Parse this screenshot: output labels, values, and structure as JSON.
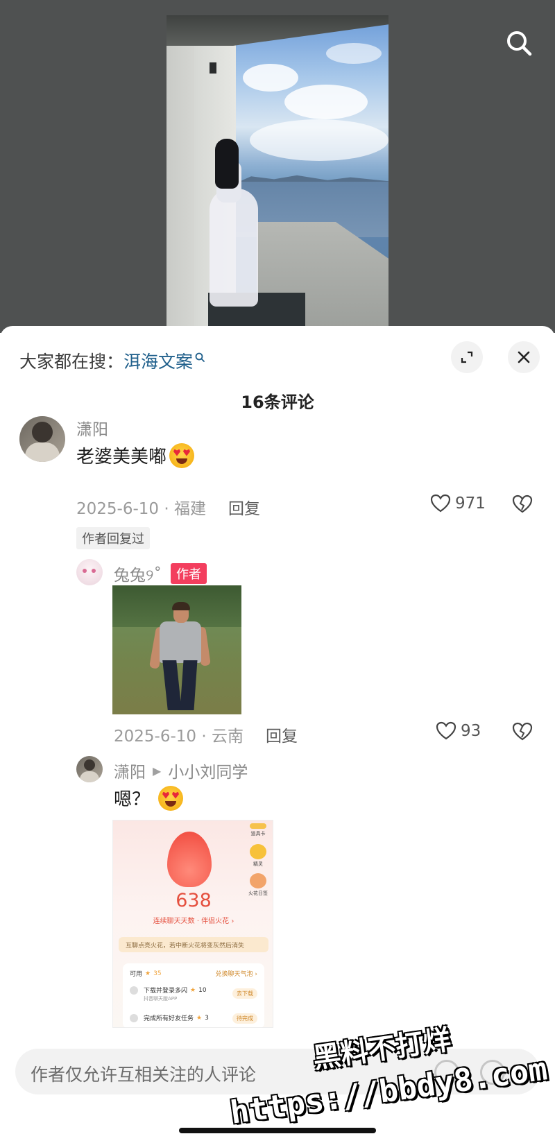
{
  "trending": {
    "prefix": "大家都在搜：",
    "query": "洱海文案"
  },
  "comments_header": {
    "count_label": "16条评论"
  },
  "comments": [
    {
      "username": "潇阳",
      "text": "老婆美美嘟",
      "emoji": "heart-eyes-emoji",
      "date_location": "2025-6-10 · 福建",
      "reply_label": "回复",
      "likes": "971",
      "author_replied": "作者回复过"
    }
  ],
  "replies": [
    {
      "username": "兔兔୨˚",
      "badge": "作者",
      "image": "game-character-photo",
      "date_location": "2025-6-10 · 云南",
      "reply_label": "回复",
      "likes": "93"
    },
    {
      "username": "潇阳",
      "reply_to": "小小刘同学",
      "text": "嗯？",
      "emoji": "heart-eyes-emoji",
      "screenshot": {
        "number": "638",
        "subtitle": "连续聊天天数 · 伴侣火花 ›",
        "tip": "互聊点亮火花，若中断火花将变灰然后消失",
        "available_label": "可用",
        "available_value": "35",
        "exchange_label": "兑换聊天气泡 ›",
        "task1_label": "下载并登录多闪",
        "task1_sub": "抖音聊天版APP",
        "task1_value": "10",
        "task1_button": "去下载",
        "task2_label": "完成所有好友任务",
        "task2_value": "3",
        "task2_button": "待完成",
        "side_labels": [
          "道具卡",
          "精灵",
          "火花日签"
        ]
      }
    }
  ],
  "input": {
    "placeholder": "作者仅允许互相关注的人评论"
  },
  "watermark": {
    "title": "黑料不打烊",
    "url": "https://bbdy8.com"
  },
  "colors": {
    "link": "#1f5f8b",
    "author_badge": "#f33e5e",
    "flame": "#e5503f"
  }
}
